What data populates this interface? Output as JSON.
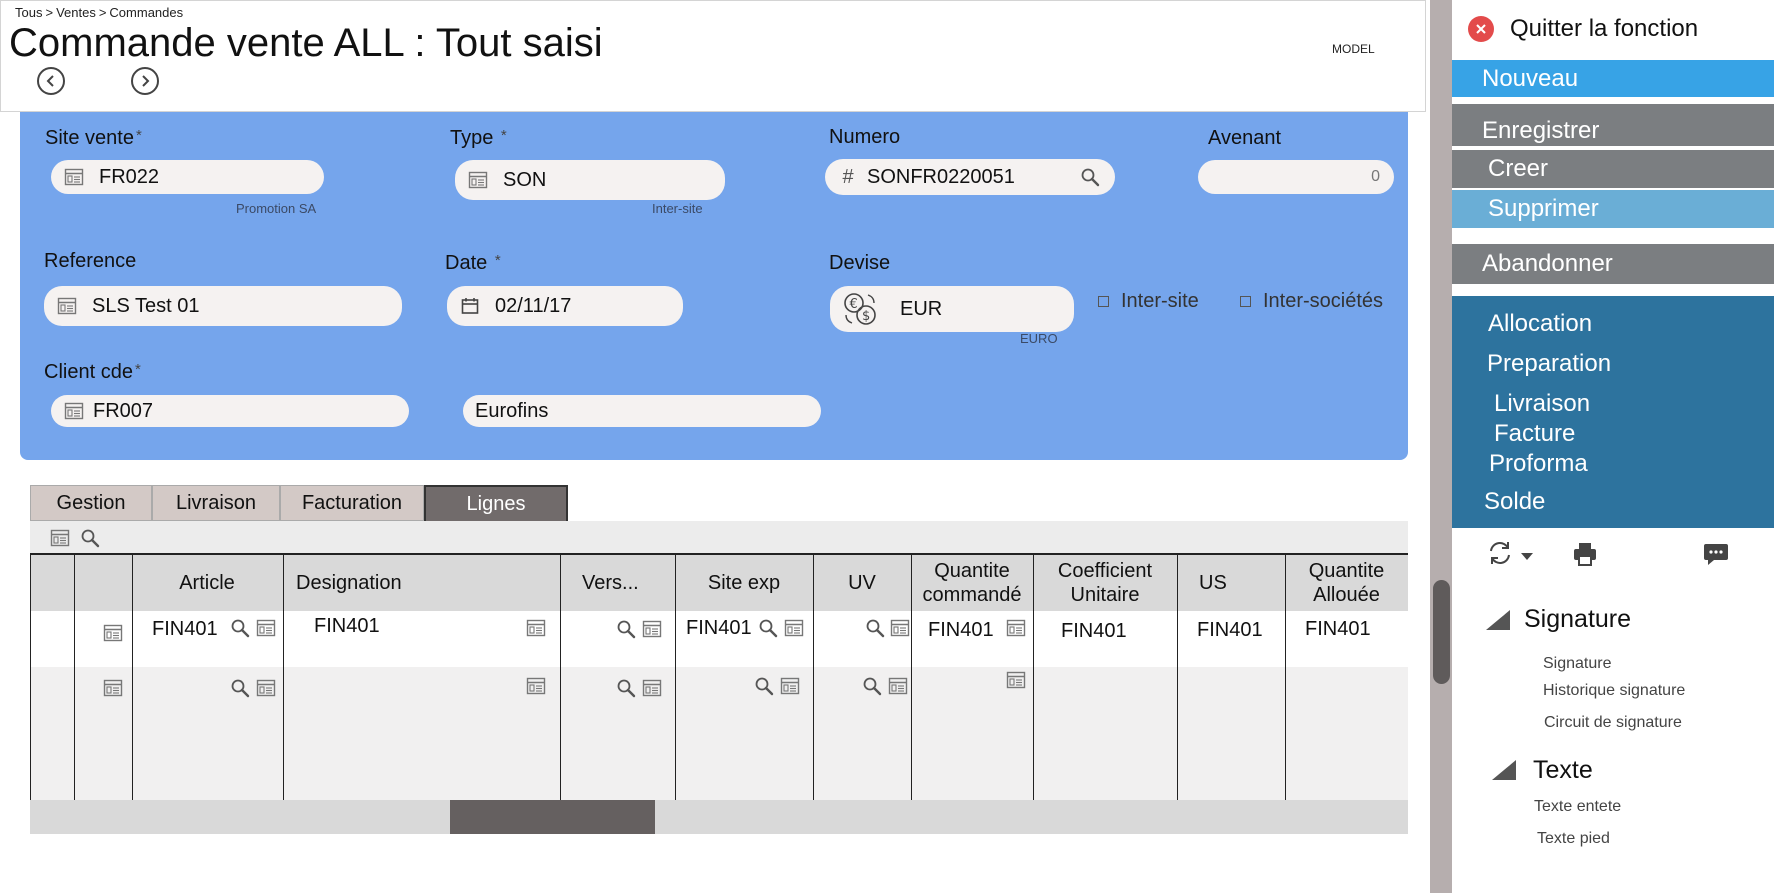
{
  "breadcrumb": {
    "item1": "Tous",
    "sep": ">",
    "item2": "Ventes",
    "item3": "Commandes"
  },
  "page": {
    "title": "Commande vente ALL : Tout saisi",
    "model_label": "MODEL"
  },
  "form": {
    "site_vente": {
      "label": "Site vente",
      "value": "FR022",
      "sub": "Promotion SA"
    },
    "type": {
      "label": "Type",
      "value": "SON",
      "sub": "Inter-site"
    },
    "numero": {
      "label": "Numero",
      "prefix": "#",
      "value": "SONFR0220051"
    },
    "avenant": {
      "label": "Avenant",
      "value": "0"
    },
    "reference": {
      "label": "Reference",
      "value": "SLS Test 01"
    },
    "date": {
      "label": "Date",
      "value": "02/11/17"
    },
    "devise": {
      "label": "Devise",
      "value": "EUR",
      "sub": "EURO"
    },
    "inter_site": {
      "label": "Inter-site"
    },
    "inter_societes": {
      "label": "Inter-sociétés"
    },
    "client_cde": {
      "label": "Client cde",
      "value": "FR007",
      "name": "Eurofins"
    },
    "required_mark": "*"
  },
  "tabs": [
    "Gestion",
    "Livraison",
    "Facturation",
    "Lignes"
  ],
  "grid": {
    "headers": {
      "article": "Article",
      "designation": "Designation",
      "vers": "Vers...",
      "site_exp": "Site exp",
      "uv": "UV",
      "qte_cmd_1": "Quantite",
      "qte_cmd_2": "commandé",
      "coef_1": "Coefficient",
      "coef_2": "Unitaire",
      "us": "US",
      "qte_all_1": "Quantite",
      "qte_all_2": "Allouée"
    },
    "row1": {
      "article": "FIN401",
      "designation": "FIN401",
      "site_exp": "FIN401",
      "qte_cmd": "FIN401",
      "coef": "FIN401",
      "us": "FIN401",
      "qte_all": "FIN401"
    }
  },
  "sidebar": {
    "quit": "Quitter la fonction",
    "nouveau": "Nouveau",
    "enregistrer": "Enregistrer",
    "creer": "Creer",
    "supprimer": "Supprimer",
    "abandonner": "Abandonner",
    "actions": [
      "Allocation",
      "Preparation",
      "Livraison",
      "Facture",
      "Proforma",
      "Solde"
    ],
    "signature_section": {
      "title": "Signature",
      "links": [
        "Signature",
        "Historique signature",
        "Circuit de signature"
      ]
    },
    "texte_section": {
      "title": "Texte",
      "links": [
        "Texte entete",
        "Texte pied"
      ]
    }
  },
  "colors": {
    "form_bg": "#75a5ec",
    "nouveau_bg": "#37a3e6",
    "grey_btn": "#7b7e81",
    "supprimer_bg": "#6aaed6",
    "actions_bg": "#2d739e",
    "close_red": "#e34b4b"
  },
  "icons": [
    "table-lookup-icon",
    "search-icon",
    "calendar-icon",
    "currency-icon",
    "refresh-icon",
    "print-icon",
    "comment-icon",
    "close-icon",
    "chevron-left-icon",
    "chevron-right-icon"
  ]
}
